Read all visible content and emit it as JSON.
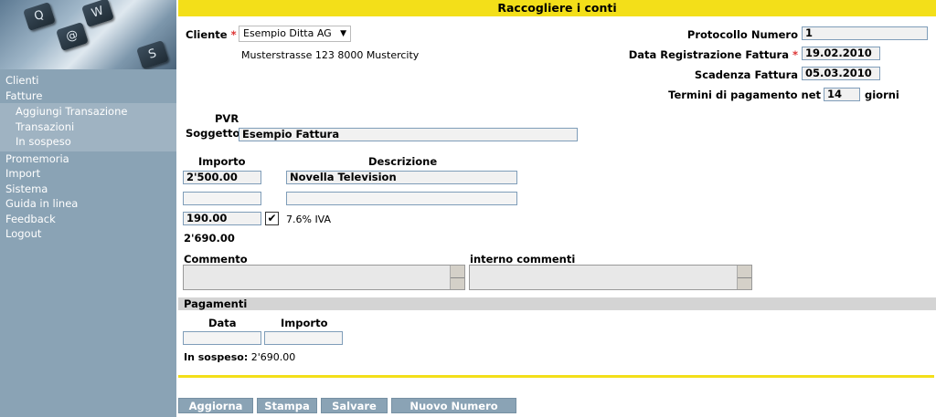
{
  "title": "Raccogliere i conti",
  "nav": {
    "items": [
      "Clienti",
      "Fatture"
    ],
    "sub_items": [
      "Aggiungi Transazione",
      "Transazioni",
      "In sospeso"
    ],
    "items_after": [
      "Promemoria",
      "Import",
      "Sistema",
      "Guida in linea",
      "Feedback",
      "Logout"
    ]
  },
  "banner_keys": [
    "Q",
    "@",
    "W",
    "S"
  ],
  "form": {
    "cliente_label": "Cliente",
    "required_mark": "*",
    "cliente_value": "Esempio Ditta AG",
    "address": "Musterstrasse 123 8000 Mustercity",
    "protocollo_label": "Protocollo Numero",
    "protocollo_value": "1",
    "data_reg_label": "Data Registrazione Fattura",
    "data_reg_value": "19.02.2010",
    "scadenza_label": "Scadenza Fattura",
    "scadenza_value": "05.03.2010",
    "termini_label": "Termini di pagamento net",
    "termini_value": "14",
    "giorni_label": "giorni",
    "pvr_label": "PVR",
    "soggetto_label": "Soggetto",
    "soggetto_value": "Esempio Fattura",
    "importo_header": "Importo",
    "descrizione_header": "Descrizione",
    "line1_importo": "2'500.00",
    "line1_descrizione": "Novella Television",
    "line2_importo": "",
    "line2_descrizione": "",
    "iva_importo": "190.00",
    "iva_checked": "✔",
    "iva_label": "7.6% IVA",
    "total": "2'690.00",
    "commento_label": "Commento",
    "interno_label": "interno commenti"
  },
  "payments": {
    "section_title": "Pagamenti",
    "data_header": "Data",
    "importo_header": "Importo",
    "data_value": "",
    "importo_value": "",
    "in_sospeso_label": "In sospeso:",
    "in_sospeso_value": "2'690.00"
  },
  "buttons": {
    "aggiorna": "Aggiorna",
    "stampa": "Stampa",
    "salvare": "Salvare",
    "nuovo_numero": "Nuovo Numero"
  },
  "colors": {
    "accent_yellow": "#f3df19",
    "sidebar": "#8aa3b5",
    "required": "#dd3333"
  }
}
